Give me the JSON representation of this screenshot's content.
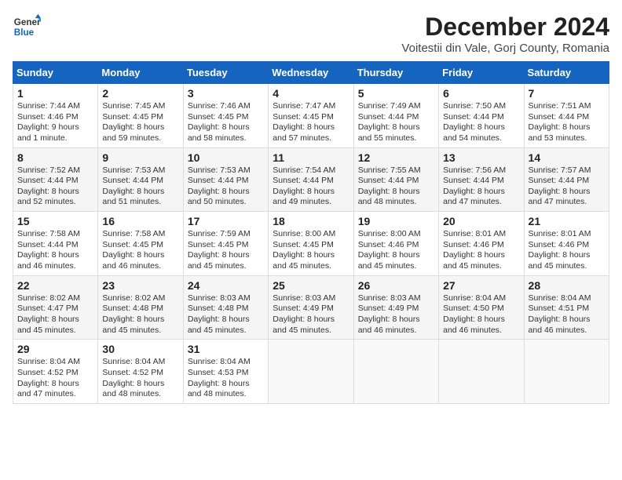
{
  "logo": {
    "line1": "General",
    "line2": "Blue"
  },
  "title": "December 2024",
  "subtitle": "Voitestii din Vale, Gorj County, Romania",
  "headers": [
    "Sunday",
    "Monday",
    "Tuesday",
    "Wednesday",
    "Thursday",
    "Friday",
    "Saturday"
  ],
  "weeks": [
    [
      {
        "day": "1",
        "info": "Sunrise: 7:44 AM\nSunset: 4:46 PM\nDaylight: 9 hours\nand 1 minute."
      },
      {
        "day": "2",
        "info": "Sunrise: 7:45 AM\nSunset: 4:45 PM\nDaylight: 8 hours\nand 59 minutes."
      },
      {
        "day": "3",
        "info": "Sunrise: 7:46 AM\nSunset: 4:45 PM\nDaylight: 8 hours\nand 58 minutes."
      },
      {
        "day": "4",
        "info": "Sunrise: 7:47 AM\nSunset: 4:45 PM\nDaylight: 8 hours\nand 57 minutes."
      },
      {
        "day": "5",
        "info": "Sunrise: 7:49 AM\nSunset: 4:44 PM\nDaylight: 8 hours\nand 55 minutes."
      },
      {
        "day": "6",
        "info": "Sunrise: 7:50 AM\nSunset: 4:44 PM\nDaylight: 8 hours\nand 54 minutes."
      },
      {
        "day": "7",
        "info": "Sunrise: 7:51 AM\nSunset: 4:44 PM\nDaylight: 8 hours\nand 53 minutes."
      }
    ],
    [
      {
        "day": "8",
        "info": "Sunrise: 7:52 AM\nSunset: 4:44 PM\nDaylight: 8 hours\nand 52 minutes."
      },
      {
        "day": "9",
        "info": "Sunrise: 7:53 AM\nSunset: 4:44 PM\nDaylight: 8 hours\nand 51 minutes."
      },
      {
        "day": "10",
        "info": "Sunrise: 7:53 AM\nSunset: 4:44 PM\nDaylight: 8 hours\nand 50 minutes."
      },
      {
        "day": "11",
        "info": "Sunrise: 7:54 AM\nSunset: 4:44 PM\nDaylight: 8 hours\nand 49 minutes."
      },
      {
        "day": "12",
        "info": "Sunrise: 7:55 AM\nSunset: 4:44 PM\nDaylight: 8 hours\nand 48 minutes."
      },
      {
        "day": "13",
        "info": "Sunrise: 7:56 AM\nSunset: 4:44 PM\nDaylight: 8 hours\nand 47 minutes."
      },
      {
        "day": "14",
        "info": "Sunrise: 7:57 AM\nSunset: 4:44 PM\nDaylight: 8 hours\nand 47 minutes."
      }
    ],
    [
      {
        "day": "15",
        "info": "Sunrise: 7:58 AM\nSunset: 4:44 PM\nDaylight: 8 hours\nand 46 minutes."
      },
      {
        "day": "16",
        "info": "Sunrise: 7:58 AM\nSunset: 4:45 PM\nDaylight: 8 hours\nand 46 minutes."
      },
      {
        "day": "17",
        "info": "Sunrise: 7:59 AM\nSunset: 4:45 PM\nDaylight: 8 hours\nand 45 minutes."
      },
      {
        "day": "18",
        "info": "Sunrise: 8:00 AM\nSunset: 4:45 PM\nDaylight: 8 hours\nand 45 minutes."
      },
      {
        "day": "19",
        "info": "Sunrise: 8:00 AM\nSunset: 4:46 PM\nDaylight: 8 hours\nand 45 minutes."
      },
      {
        "day": "20",
        "info": "Sunrise: 8:01 AM\nSunset: 4:46 PM\nDaylight: 8 hours\nand 45 minutes."
      },
      {
        "day": "21",
        "info": "Sunrise: 8:01 AM\nSunset: 4:46 PM\nDaylight: 8 hours\nand 45 minutes."
      }
    ],
    [
      {
        "day": "22",
        "info": "Sunrise: 8:02 AM\nSunset: 4:47 PM\nDaylight: 8 hours\nand 45 minutes."
      },
      {
        "day": "23",
        "info": "Sunrise: 8:02 AM\nSunset: 4:48 PM\nDaylight: 8 hours\nand 45 minutes."
      },
      {
        "day": "24",
        "info": "Sunrise: 8:03 AM\nSunset: 4:48 PM\nDaylight: 8 hours\nand 45 minutes."
      },
      {
        "day": "25",
        "info": "Sunrise: 8:03 AM\nSunset: 4:49 PM\nDaylight: 8 hours\nand 45 minutes."
      },
      {
        "day": "26",
        "info": "Sunrise: 8:03 AM\nSunset: 4:49 PM\nDaylight: 8 hours\nand 46 minutes."
      },
      {
        "day": "27",
        "info": "Sunrise: 8:04 AM\nSunset: 4:50 PM\nDaylight: 8 hours\nand 46 minutes."
      },
      {
        "day": "28",
        "info": "Sunrise: 8:04 AM\nSunset: 4:51 PM\nDaylight: 8 hours\nand 46 minutes."
      }
    ],
    [
      {
        "day": "29",
        "info": "Sunrise: 8:04 AM\nSunset: 4:52 PM\nDaylight: 8 hours\nand 47 minutes."
      },
      {
        "day": "30",
        "info": "Sunrise: 8:04 AM\nSunset: 4:52 PM\nDaylight: 8 hours\nand 48 minutes."
      },
      {
        "day": "31",
        "info": "Sunrise: 8:04 AM\nSunset: 4:53 PM\nDaylight: 8 hours\nand 48 minutes."
      },
      null,
      null,
      null,
      null
    ]
  ]
}
